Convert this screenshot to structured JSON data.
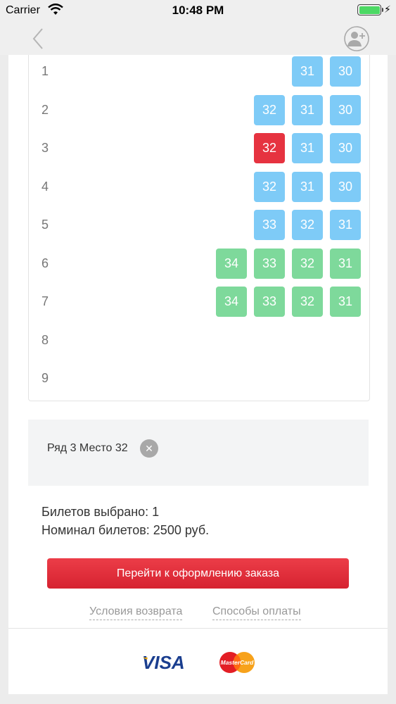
{
  "status_bar": {
    "carrier": "Carrier",
    "time": "10:48 PM",
    "wifi_icon": "wifi-icon",
    "battery_icon": "battery-icon",
    "charging_icon": "⚡"
  },
  "nav": {
    "back_icon": "chevron-left-icon",
    "add_user_icon": "add-user-icon"
  },
  "seat_map": {
    "rows": [
      {
        "label": "1",
        "seats": [
          {
            "number": "31",
            "status": "available-blue"
          },
          {
            "number": "30",
            "status": "available-blue"
          }
        ]
      },
      {
        "label": "2",
        "seats": [
          {
            "number": "32",
            "status": "available-blue"
          },
          {
            "number": "31",
            "status": "available-blue"
          },
          {
            "number": "30",
            "status": "available-blue"
          }
        ]
      },
      {
        "label": "3",
        "seats": [
          {
            "number": "32",
            "status": "selected"
          },
          {
            "number": "31",
            "status": "available-blue"
          },
          {
            "number": "30",
            "status": "available-blue"
          }
        ]
      },
      {
        "label": "4",
        "seats": [
          {
            "number": "32",
            "status": "available-blue"
          },
          {
            "number": "31",
            "status": "available-blue"
          },
          {
            "number": "30",
            "status": "available-blue"
          }
        ]
      },
      {
        "label": "5",
        "seats": [
          {
            "number": "33",
            "status": "available-blue"
          },
          {
            "number": "32",
            "status": "available-blue"
          },
          {
            "number": "31",
            "status": "available-blue"
          }
        ]
      },
      {
        "label": "6",
        "seats": [
          {
            "number": "34",
            "status": "available-green"
          },
          {
            "number": "33",
            "status": "available-green"
          },
          {
            "number": "32",
            "status": "available-green"
          },
          {
            "number": "31",
            "status": "available-green"
          }
        ]
      },
      {
        "label": "7",
        "seats": [
          {
            "number": "34",
            "status": "available-green"
          },
          {
            "number": "33",
            "status": "available-green"
          },
          {
            "number": "32",
            "status": "available-green"
          },
          {
            "number": "31",
            "status": "available-green"
          }
        ]
      },
      {
        "label": "8",
        "seats": []
      },
      {
        "label": "9",
        "seats": []
      }
    ]
  },
  "selected": {
    "text": "Ряд 3 Место 32",
    "remove_symbol": "✕"
  },
  "summary": {
    "tickets_selected": "Билетов выбрано: 1",
    "tickets_nominal": "Номинал билетов: 2500 руб."
  },
  "checkout_button": "Перейти к оформлению заказа",
  "links": {
    "refund": "Условия возврата",
    "payment": "Способы оплаты"
  },
  "payment_logos": {
    "visa": "VISA",
    "mastercard": "MasterCard"
  },
  "colors": {
    "seat_blue": "#7ecbf7",
    "seat_green": "#7ed99b",
    "seat_selected": "#e63340",
    "accent_red": "#e63340"
  }
}
